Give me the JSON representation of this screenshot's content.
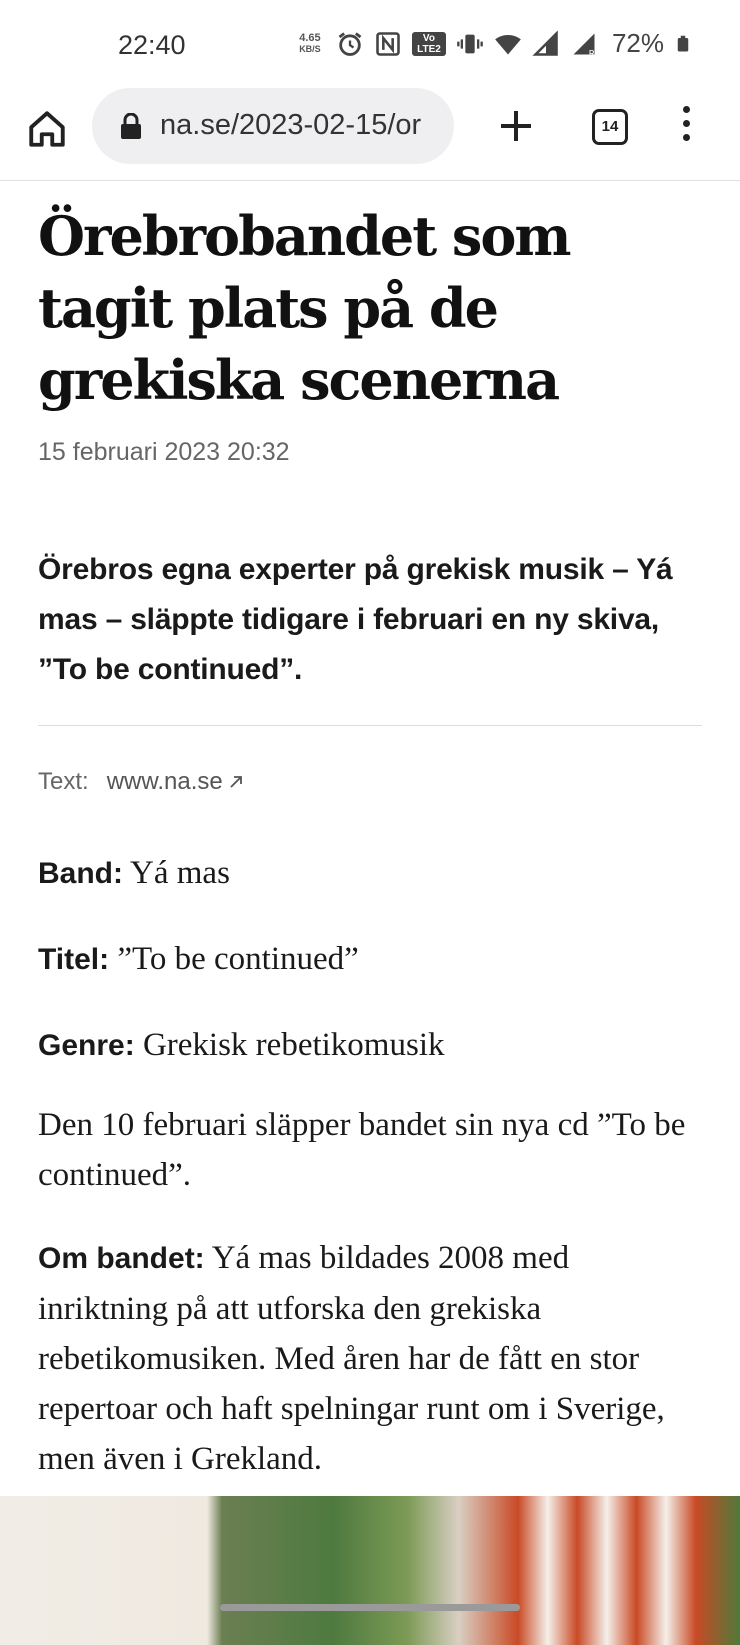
{
  "status_bar": {
    "time": "22:40",
    "net_speed_value": "4.65",
    "net_speed_unit": "KB/S",
    "volte_label": "Vo LTE2",
    "battery_percent": "72%",
    "icons": [
      "alarm-icon",
      "nfc-icon",
      "volte-icon",
      "vibrate-icon",
      "wifi-icon",
      "signal-icon",
      "signal-roaming-icon",
      "battery-icon"
    ]
  },
  "browser": {
    "url": "na.se/2023-02-15/or",
    "tab_count": "14"
  },
  "article": {
    "headline": "Örebrobandet som tagit plats på de grekiska scenerna",
    "date": "15 februari 2023 20:32",
    "lede": "Örebros egna experter på grekisk musik – Yá mas – släppte tidigare i februari en ny skiva, ”To be continued”.",
    "credit_label": "Text:",
    "credit_link": "www.na.se",
    "facts": [
      {
        "label": "Band:",
        "value": " Yá mas"
      },
      {
        "label": "Titel:",
        "value": " ”To be continued”"
      },
      {
        "label": "Genre:",
        "value": " Grekisk rebetikomusik"
      }
    ],
    "paragraph1": "Den 10 februari släpper bandet sin nya cd ”To be continued”.",
    "paragraph2_label": "Om bandet:",
    "paragraph2": " Yá mas bildades 2008 med inriktning på att utforska den grekiska rebetikomusiken. Med åren har de fått en stor repertoar och haft spelningar runt om i Sverige, men även i Grekland."
  }
}
